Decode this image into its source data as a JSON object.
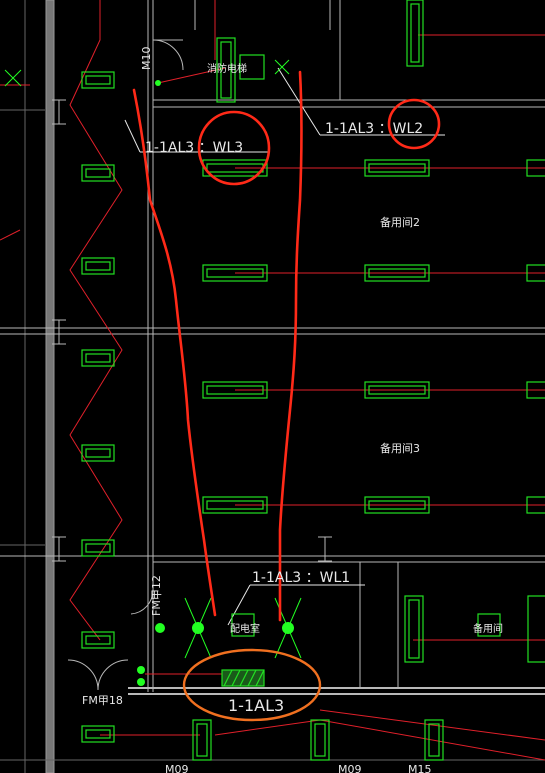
{
  "colors": {
    "background": "#000000",
    "wall": "#b8b8b8",
    "wiring": "#e0202a",
    "fixture": "#22e022",
    "markup_red": "#ff2a18",
    "markup_orange": "#f07020",
    "text": "#e8e8e8",
    "node": "#22ff22"
  },
  "labels": {
    "circuit_wl3": "1-1AL3  ：WL3",
    "circuit_wl2": "1-1AL3  ：WL2",
    "circuit_wl1": "1-1AL3    ：WL1",
    "panel": "1-1AL3",
    "room_standby2": "备用间2",
    "room_standby3": "备用间3",
    "door_m10": "M10",
    "door_fm12": "FM甲12",
    "door_fm18": "FM甲18",
    "door_m09_left": "M09",
    "door_m09_right": "M09",
    "door_m15": "M15",
    "equip_top": "消防电梯",
    "equip_mid": "配电室",
    "equip_right": "备用间"
  },
  "markup": {
    "circled": [
      "WL3",
      "WL2",
      "1-1AL3"
    ]
  }
}
